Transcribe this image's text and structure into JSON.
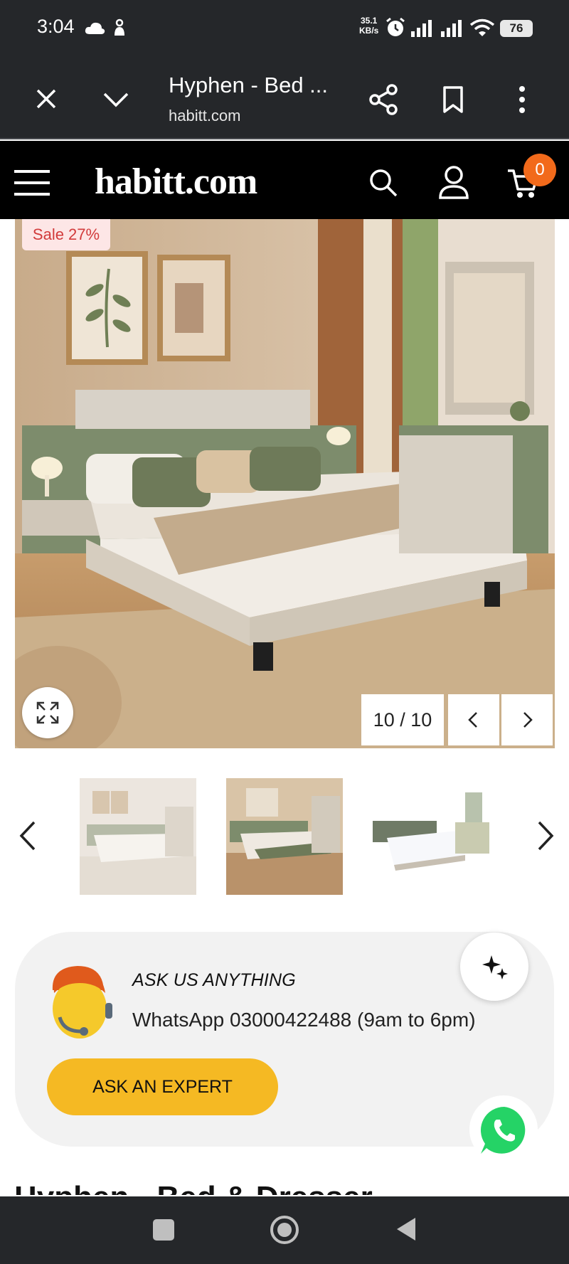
{
  "status_bar": {
    "time": "3:04",
    "net_speed_value": "35.1",
    "net_speed_unit": "KB/s",
    "battery": "76",
    "icons": [
      "cloud-icon",
      "app-notification-icon",
      "alarm-icon",
      "signal-icon",
      "signal-icon",
      "wifi-icon",
      "battery-icon"
    ]
  },
  "browser": {
    "title": "Hyphen - Bed ...",
    "url": "habitt.com",
    "icons": [
      "close-icon",
      "chevron-down-icon",
      "share-icon",
      "bookmark-icon",
      "more-vert-icon"
    ]
  },
  "header": {
    "logo": "habitt.com",
    "cart_count": "0",
    "icons": [
      "menu-icon",
      "search-icon",
      "user-icon",
      "cart-icon"
    ]
  },
  "product": {
    "sale_label": "Sale 27%",
    "image_counter": "10 / 10",
    "title_partial": "Hyphen - Bed & Dresser"
  },
  "ask": {
    "title": "ASK US ANYTHING",
    "whatsapp_line": "WhatsApp 03000422488 (9am to 6pm)",
    "button_label": "ASK AN EXPERT"
  },
  "colors": {
    "accent_yellow": "#f5b923",
    "cart_badge": "#f26a1b",
    "sale_text": "#d23b3b",
    "whatsapp_green": "#25d366",
    "sage": "#7d8c6c"
  }
}
